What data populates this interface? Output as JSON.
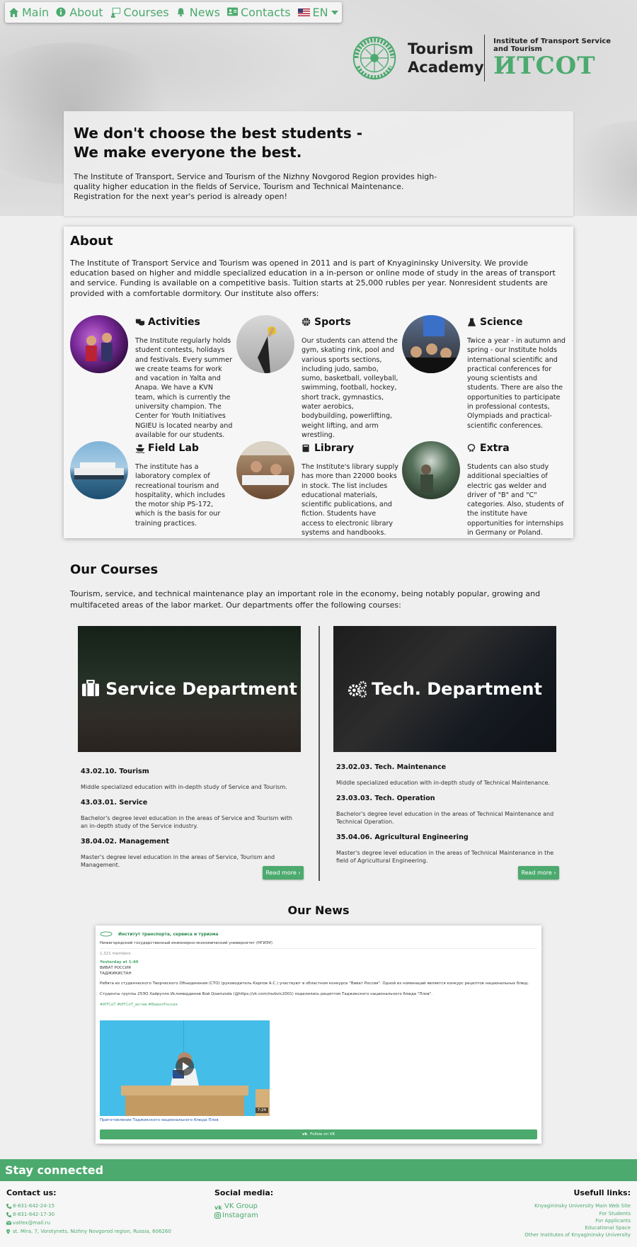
{
  "nav": {
    "items": [
      {
        "label": "Main",
        "icon": "home-icon"
      },
      {
        "label": "About",
        "icon": "info-icon"
      },
      {
        "label": "Courses",
        "icon": "courses-icon"
      },
      {
        "label": "News",
        "icon": "bell-icon"
      },
      {
        "label": "Contacts",
        "icon": "contact-card-icon"
      }
    ],
    "language": "EN"
  },
  "logo": {
    "name": "Tourism Academy",
    "emblem_text": "АКАДЕМИЯ ТУРИЗМА",
    "institute": "Institute of Transport Service and Tourism",
    "abbr": "ИТСОТ"
  },
  "hero": {
    "title_line1": "We don't choose the best students -",
    "title_line2": "We make everyone the best.",
    "text": "The Institute of Transport, Service and Tourism of the Nizhny Novgorod Region provides high-quality higher education in the fields of Service, Tourism and Technical Maintenance. Registration for the next year's period is already open!"
  },
  "about": {
    "title": "About",
    "intro": "The Institute of Transport Service and Tourism was opened in 2011 and is part of Knyagininsky University. We provide education based on higher and middle specialized education in a in-person or online mode of study in the areas of transport and service. Funding is available on a competitive basis. Tuition starts at 25,000 rubles per year. Nonresident students are provided with a comfortable dormitory. Our institute also offers:",
    "features": [
      {
        "title": "Activities",
        "icon": "masks-icon",
        "text": "The Institute regularly holds student contests, holidays and festivals. Every summer we create teams for work and vacation in Yalta and Anapa. We have a KVN team, which is currently the university champion. The Center for Youth Initiatives NGIEU is located nearby and available for our students."
      },
      {
        "title": "Sports",
        "icon": "basketball-icon",
        "text": "Our students can attend the gym, skating rink, pool and various sports sections, including judo, sambo, sumo, basketball, volleyball, swimming, football, hockey, short track, gymnastics, water aerobics, bodybuilding, powerlifting, weight lifting, and arm wrestling."
      },
      {
        "title": "Science",
        "icon": "flask-icon",
        "text": "Twice a year - in autumn and spring - our Institute holds international scientific and practical conferences for young scientists and students. There are also the opportunities to participate in professional contests, Olympiads and practical-scientific conferences."
      },
      {
        "title": "Field Lab",
        "icon": "ship-icon",
        "text": "The institute has a laboratory complex of recreational tourism and hospitality, which includes the motor ship PS-172, which is the basis for our training practices."
      },
      {
        "title": "Library",
        "icon": "book-icon",
        "text": "The Institute's library supply has more than 22000 books in stock. The list includes educational materials, scientific publications, and fiction. Students have access to electronic library systems and handbooks."
      },
      {
        "title": "Extra",
        "icon": "omega-icon",
        "text": "Students can also study additional specialties of electric gas welder and driver of \"B\" and \"C\" categories. Also, students of the institute have opportunities for internships in Germany or Poland."
      }
    ]
  },
  "courses": {
    "title": "Our Courses",
    "intro": "Tourism, service, and technical maintenance play an important role in the economy, being notably popular, growing and multifaceted areas of the labor market. Our departments offer the following courses:",
    "departments": [
      {
        "name": "Service Department",
        "icon": "briefcase-icon",
        "courses": [
          {
            "code": "43.02.10. Tourism",
            "desc": "Middle specialized education with in-depth study of Service and Tourism."
          },
          {
            "code": "43.03.01. Service",
            "desc": "Bachelor's degree level education in the areas of Service and Tourism with an in-depth study of the Service industry."
          },
          {
            "code": "38.04.02. Management",
            "desc": "Master's degree level education in the areas of Service, Tourism and Management."
          }
        ],
        "read_more": "Read more"
      },
      {
        "name": "Tech. Department",
        "icon": "gears-icon",
        "courses": [
          {
            "code": "23.02.03. Tech. Maintenance",
            "desc": "Middle specialized education with in-depth study of Technical Maintenance."
          },
          {
            "code": "23.03.03. Tech. Operation",
            "desc": "Bachelor's degree level education in the areas of Technical Maintenance and Technical Operation."
          },
          {
            "code": "35.04.06. Agricultural Engineering",
            "desc": "Master's degree level education in the areas of Technical Maintenance in the field of Agricultural Engineering."
          }
        ],
        "read_more": "Read more"
      }
    ]
  },
  "news": {
    "title": "Our News",
    "widget": {
      "group": "Институт транспорта, сервиса и туризма",
      "university": "Нижегородский государственный инженерно-экономический университет (НГИЭУ)",
      "members": "1,321 members",
      "when": "Yesterday at 1:40",
      "line1": "ВИВАТ РОССИЯ",
      "line2": "ТАДЖИКИСТАН",
      "para1": "Ребята из студенческого Творческого Объединения (СТО) (руководитель Карпов А.С.) участвуют в областном конкурсе \"Виват Россия\". Одной из номинаций является конкурс рецептов национальных блюд.",
      "para2": "Студенты группы 25ЭО Хайрулло Исломиддинов Вой Qoamzoda (@https://vk.com/mubvic2001) поделились рецептом Таджикского национального блюда \"Плов\".",
      "tags": "#ИТСоТ #ИТСоТ_актив #ВиватРоссия",
      "video_duration": "7:24",
      "caption": "Приготовление Таджикского национального блюда Плов",
      "follow": "Follow on VK"
    }
  },
  "footer": {
    "bar": "Stay connected",
    "contact": {
      "title": "Contact us:",
      "phone1": "8-831-642-24-15",
      "phone2": "8-831-642-17-30",
      "email": "vatlex@mail.ru",
      "address": "st. Mira, 7, Vorotynets, Nizhny Novgorod region, Russia, 606260"
    },
    "social": {
      "title": "Social media:",
      "vk": "VK Group",
      "instagram": "Instagram"
    },
    "useful": {
      "title": "Usefull links:",
      "links": [
        "Knyagininsky University Main Web Site",
        "For Students",
        "For Applicants",
        "Educational Space",
        "Other Institutes of Knyagininsky University"
      ]
    }
  },
  "colors": {
    "accent": "#4caa6e",
    "text": "#222222",
    "background": "#efefef"
  }
}
